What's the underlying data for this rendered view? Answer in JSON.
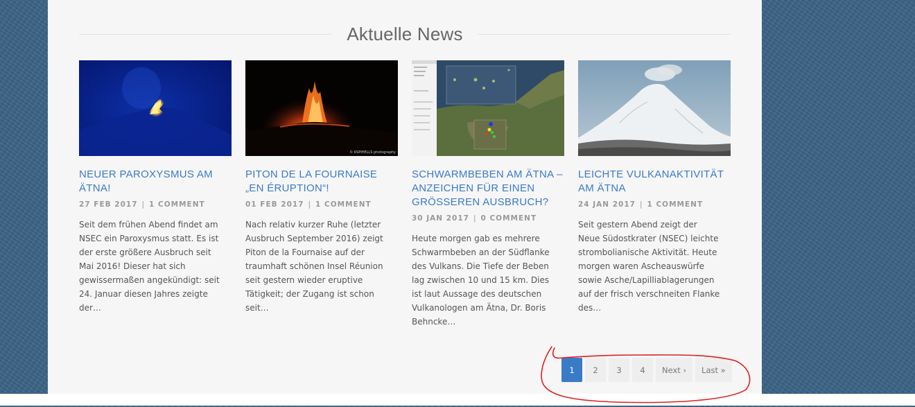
{
  "section": {
    "title": "Aktuelle News"
  },
  "posts": [
    {
      "title": "NEUER PAROXYSMUS AM ÄTNA!",
      "date": "27 FEB 2017",
      "separator": "|",
      "comments": "1 COMMENT",
      "excerpt": "Seit dem frühen Abend findet am NSEC ein Paroxysmus statt. Es ist der erste größere Ausbruch seit Mai 2016! Dieser hat sich gewissermaßen angekündigt: seit 24. Januar diesen Jahres zeigte der…"
    },
    {
      "title": "PITON DE LA FOURNAISE „EN ÉRUPTION“!",
      "date": "01 FEB 2017",
      "separator": "|",
      "comments": "1 COMMENT",
      "excerpt": "Nach relativ kurzer Ruhe (letzter Ausbruch September 2016) zeigt Piton de la Fournaise auf der traumhaft schönen Insel Réunion seit gestern wieder eruptive Tätigkeit; der Zugang ist schon seit…",
      "image_caption": "© KSPIHELLS photography"
    },
    {
      "title": "SCHWARMBEBEN AM ÄTNA – ANZEICHEN FÜR EINEN GRÖSSEREN AUSBRUCH?",
      "date": "30 JAN 2017",
      "separator": "|",
      "comments": "0 COMMENT",
      "excerpt": "Heute morgen gab es mehrere Schwarmbeben an der Südflanke des Vulkans. Die Tiefe der Beben lag zwischen 10 und 15 km. Dies ist laut Aussage des deutschen Vulkanologen am Ätna, Dr. Boris Behncke…"
    },
    {
      "title": "LEICHTE VULKANAKTIVITÄT AM ÄTNA",
      "date": "24 JAN 2017",
      "separator": "|",
      "comments": "1 COMMENT",
      "excerpt": "Seit gestern Abend zeigt der Neue Südostkrater (NSEC) leichte strombolianische Aktivität. Heute morgen waren Ascheauswürfe sowie Asche/Lapilliablagerungen auf der frisch verschneiten Flanke des…"
    }
  ],
  "pagination": {
    "pages": [
      "1",
      "2",
      "3",
      "4"
    ],
    "current": "1",
    "next": "Next ›",
    "last": "Last »"
  },
  "colors": {
    "accent": "#3a7bc8",
    "background": "#3d6486",
    "panel": "#f6f6f6",
    "annotation": "#e02020"
  }
}
